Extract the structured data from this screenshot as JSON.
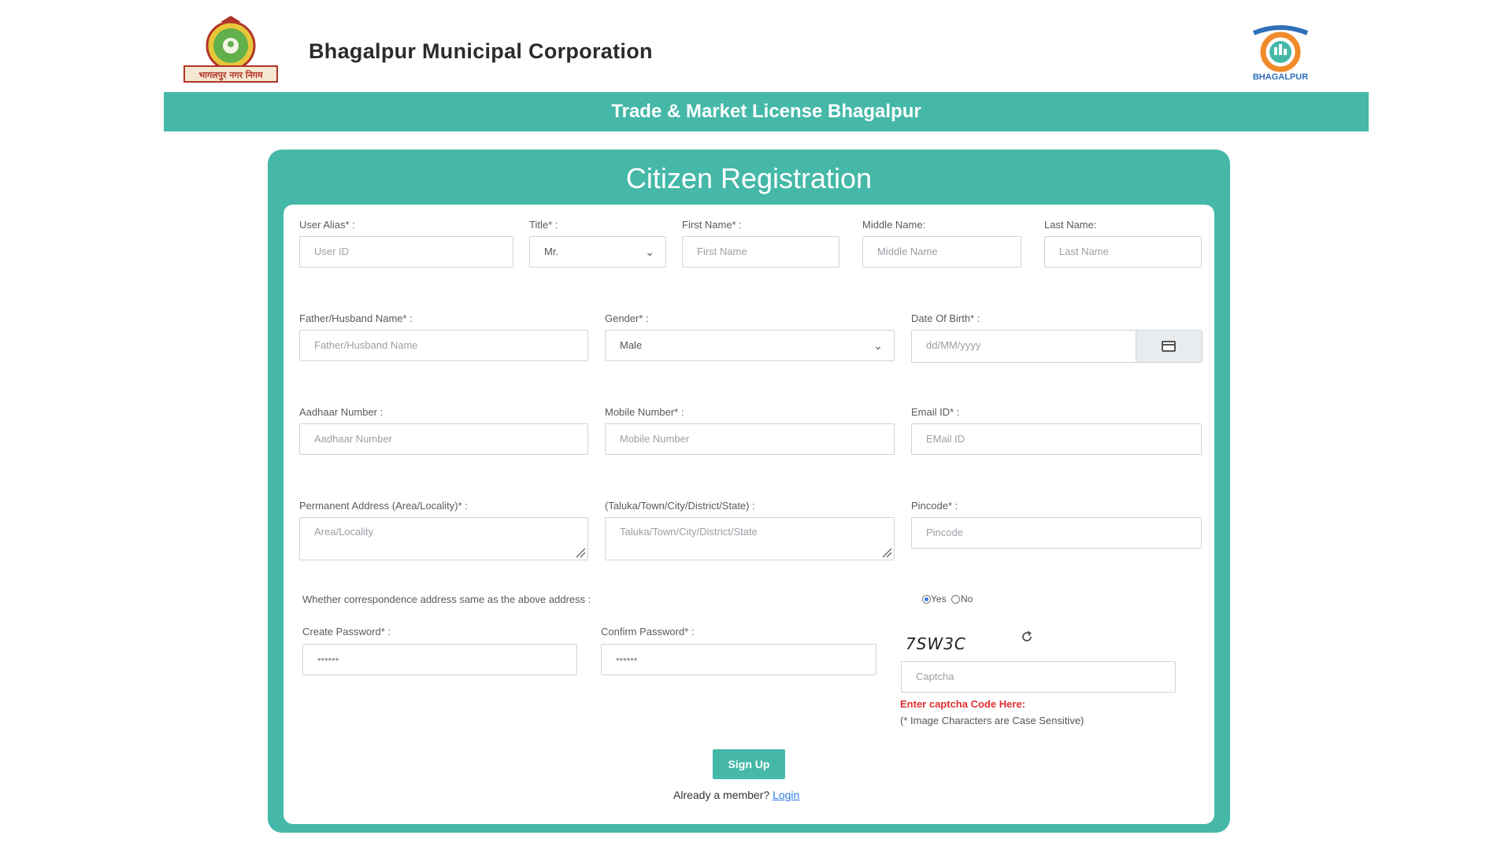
{
  "header": {
    "org_name": "Bhagalpur Municipal Corporation",
    "logo_left_text": "भागलपुर नगर निगम",
    "logo_right_text": "BHAGALPUR"
  },
  "banner": {
    "title": "Trade & Market License Bhagalpur"
  },
  "form": {
    "title": "Citizen Registration",
    "user_alias": {
      "label": "User Alias* :",
      "placeholder": "User ID"
    },
    "title_field": {
      "label": "Title* :",
      "value": "Mr."
    },
    "first_name": {
      "label": "First Name* :",
      "placeholder": "First Name"
    },
    "middle_name": {
      "label": "Middle Name:",
      "placeholder": "Middle Name"
    },
    "last_name": {
      "label": "Last Name:",
      "placeholder": "Last Name"
    },
    "father_name": {
      "label": "Father/Husband Name* :",
      "placeholder": "Father/Husband Name"
    },
    "gender": {
      "label": "Gender* :",
      "value": "Male"
    },
    "dob": {
      "label": "Date Of Birth* :",
      "placeholder": "dd/MM/yyyy"
    },
    "aadhaar": {
      "label": "Aadhaar Number :",
      "placeholder": "Aadhaar Number"
    },
    "mobile": {
      "label": "Mobile Number* :",
      "placeholder": "Mobile Number"
    },
    "email": {
      "label": "Email ID* :",
      "placeholder": "EMail ID"
    },
    "perm_address": {
      "label": "Permanent Address (Area/Locality)* :",
      "placeholder": "Area/Locality"
    },
    "taluka": {
      "label": "(Taluka/Town/City/District/State) :",
      "placeholder": "Taluka/Town/City/District/State"
    },
    "pincode": {
      "label": "Pincode* :",
      "placeholder": "Pincode"
    },
    "correspondence": {
      "question": "Whether correspondence address same as the above address :",
      "yes_label": "Yes",
      "no_label": "No",
      "selected": "Yes"
    },
    "create_password": {
      "label": "Create Password* :",
      "placeholder": "••••••"
    },
    "confirm_password": {
      "label": "Confirm Password* :",
      "placeholder": "••••••"
    },
    "captcha": {
      "image_text": "7SW3C",
      "placeholder": "Captcha",
      "hint": "Enter captcha Code Here:",
      "note": "(* Image Characters are Case Sensitive)"
    },
    "signup_label": "Sign Up",
    "member_text": "Already a member?",
    "login_label": "Login"
  },
  "colors": {
    "accent": "#45b8a8",
    "error": "#e03030",
    "link": "#2f7be8"
  }
}
